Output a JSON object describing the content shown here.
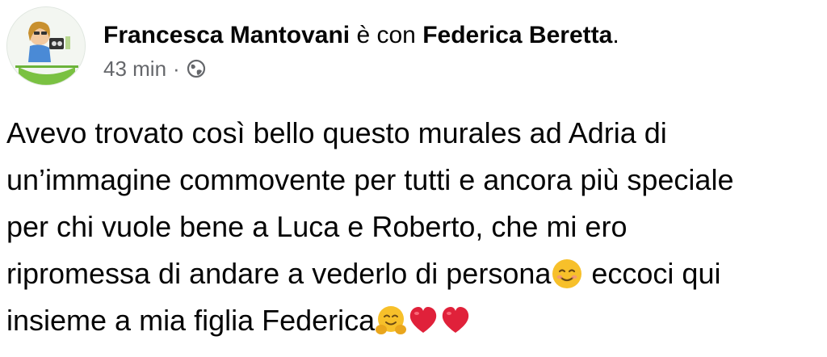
{
  "post": {
    "author": "Francesca Mantovani",
    "connector": "è con",
    "tagged": "Federica Beretta",
    "period": ".",
    "time": "43 min",
    "separator": "·",
    "privacy_icon": "globe-icon",
    "text_lines": [
      {
        "text": "Avevo trovato così bello questo murales ad Adria di"
      },
      {
        "text": "un’immagine commovente per tutti e ancora più speciale"
      },
      {
        "text": "per chi vuole bene a Luca e Roberto, che mi ero"
      },
      {
        "pre": "ripromessa di andare a vederlo di persona",
        "emoji": "smiling-face-icon",
        "post": " eccoci qui"
      },
      {
        "pre": "insieme a mia figlia Federica",
        "emojis": [
          "hugging-face-icon",
          "red-heart-icon",
          "red-heart-icon"
        ]
      }
    ]
  },
  "colors": {
    "text": "#050505",
    "secondary_text": "#65676b",
    "heart_red": "#e0213a",
    "emoji_yellow": "#f7c02a"
  }
}
